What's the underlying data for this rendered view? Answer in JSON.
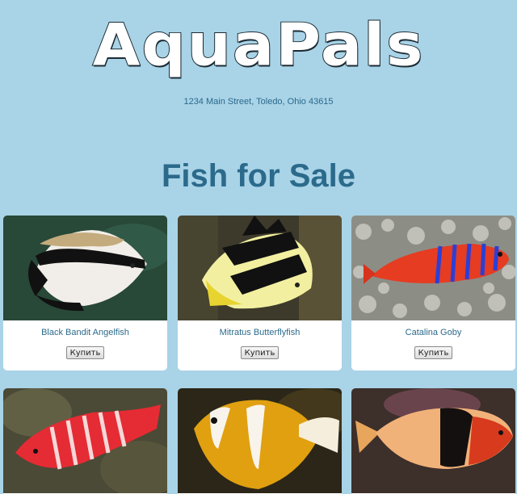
{
  "header": {
    "logo_text": "AquaPals",
    "address": "1234 Main Street, Toledo, Ohio 43615"
  },
  "main": {
    "title": "Fish for Sale",
    "buy_label": "Купить",
    "products": [
      {
        "name": "Black Bandit Angelfish",
        "image": "black-bandit-angelfish-photo"
      },
      {
        "name": "Mitratus Butterflyfish",
        "image": "mitratus-butterflyfish-photo"
      },
      {
        "name": "Catalina Goby",
        "image": "catalina-goby-photo"
      },
      {
        "name": "",
        "image": "red-striped-hawkfish-photo"
      },
      {
        "name": "",
        "image": "clownfish-photo"
      },
      {
        "name": "",
        "image": "orange-black-hogfish-photo"
      }
    ]
  },
  "colors": {
    "background": "#a9d3e7",
    "text": "#2b6a8b",
    "card": "#ffffff"
  }
}
